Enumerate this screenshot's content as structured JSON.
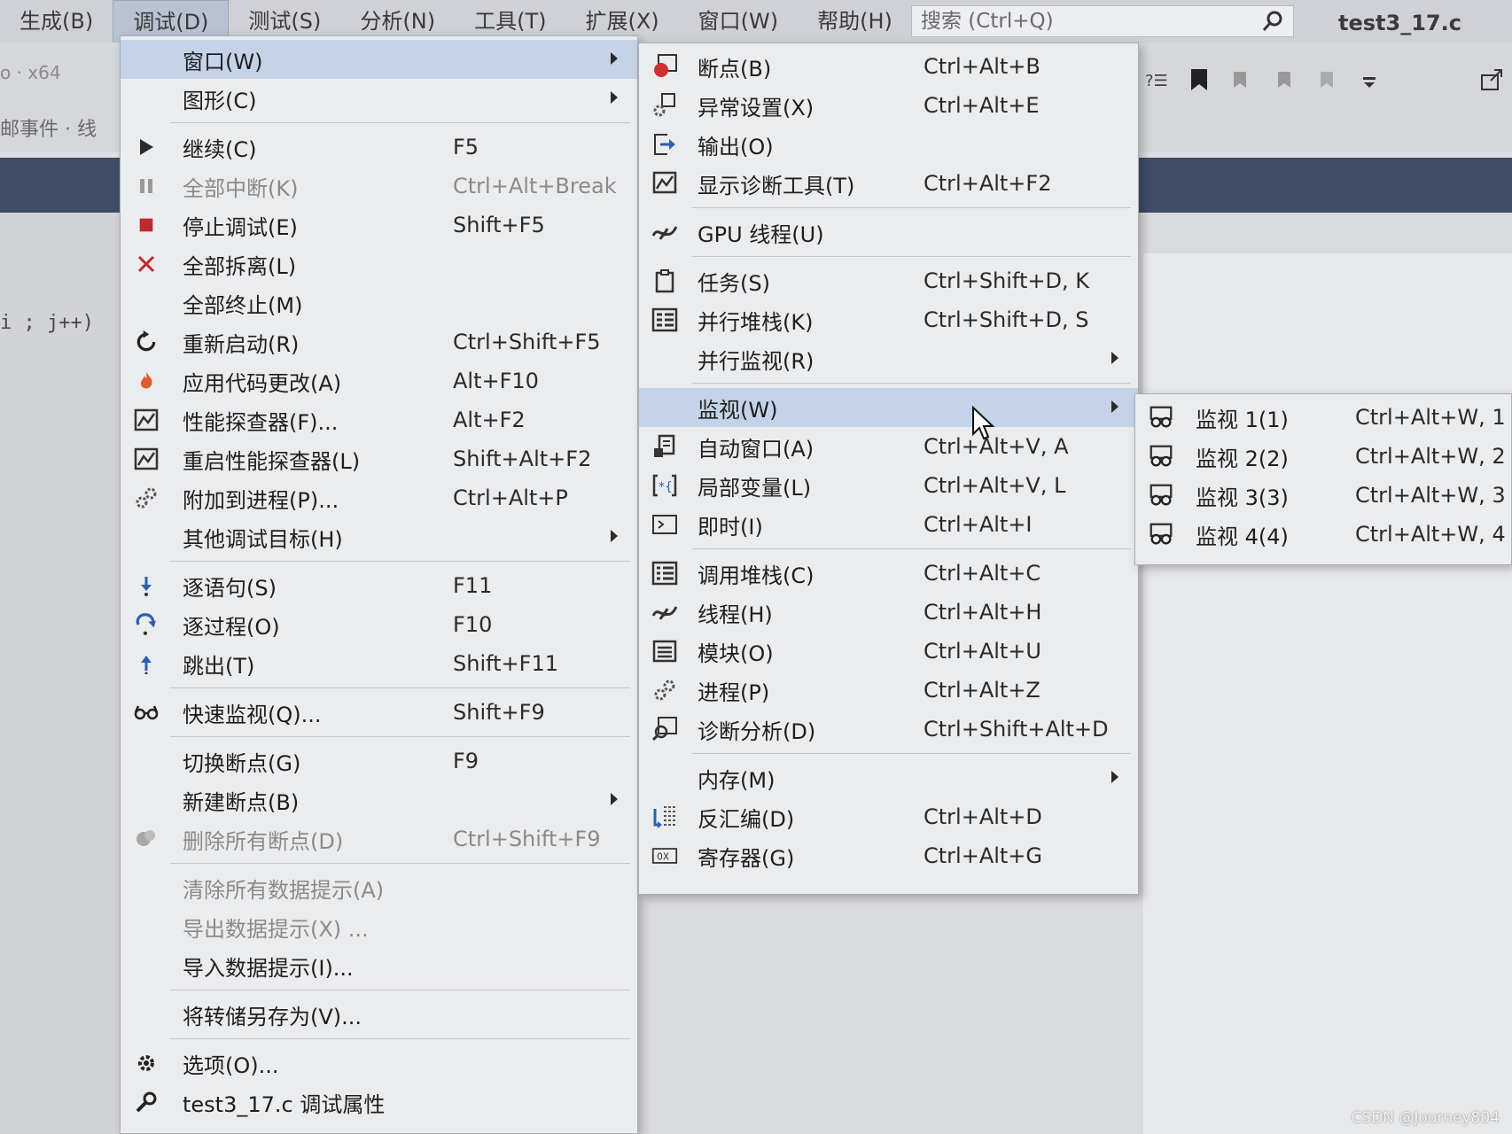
{
  "menubar": {
    "items": [
      "生成(B)",
      "调试(D)",
      "测试(S)",
      "分析(N)",
      "工具(T)",
      "扩展(X)",
      "窗口(W)",
      "帮助(H)"
    ],
    "active_index": 1,
    "search_placeholder": "搜索 (Ctrl+Q)",
    "project_title": "test3_17.c"
  },
  "toolbar": {
    "left_text_1": "o  ·  x64",
    "left_text_2": "邮事件 · 线"
  },
  "editor": {
    "code_fragment": "i ; j++)"
  },
  "debug_menu": {
    "items": [
      {
        "type": "item",
        "icon": "window-icon",
        "label": "窗口(W)",
        "shortcut": "",
        "submenu": true,
        "selected": true
      },
      {
        "type": "item",
        "icon": "",
        "label": "图形(C)",
        "shortcut": "",
        "submenu": true
      },
      {
        "type": "sep"
      },
      {
        "type": "item",
        "icon": "play-icon",
        "label": "继续(C)",
        "shortcut": "F5"
      },
      {
        "type": "item",
        "icon": "pause-icon",
        "label": "全部中断(K)",
        "shortcut": "Ctrl+Alt+Break",
        "disabled": true
      },
      {
        "type": "item",
        "icon": "stop-icon",
        "label": "停止调试(E)",
        "shortcut": "Shift+F5"
      },
      {
        "type": "item",
        "icon": "close-icon",
        "label": "全部拆离(L)",
        "shortcut": ""
      },
      {
        "type": "item",
        "icon": "",
        "label": "全部终止(M)",
        "shortcut": ""
      },
      {
        "type": "item",
        "icon": "restart-icon",
        "label": "重新启动(R)",
        "shortcut": "Ctrl+Shift+F5"
      },
      {
        "type": "item",
        "icon": "flame-icon",
        "label": "应用代码更改(A)",
        "shortcut": "Alt+F10"
      },
      {
        "type": "item",
        "icon": "profiler-icon",
        "label": "性能探查器(F)...",
        "shortcut": "Alt+F2"
      },
      {
        "type": "item",
        "icon": "profiler-icon",
        "label": "重启性能探查器(L)",
        "shortcut": "Shift+Alt+F2"
      },
      {
        "type": "item",
        "icon": "gears-icon",
        "label": "附加到进程(P)...",
        "shortcut": "Ctrl+Alt+P"
      },
      {
        "type": "item",
        "icon": "",
        "label": "其他调试目标(H)",
        "shortcut": "",
        "submenu": true
      },
      {
        "type": "sep"
      },
      {
        "type": "item",
        "icon": "step-into-icon",
        "label": "逐语句(S)",
        "shortcut": "F11"
      },
      {
        "type": "item",
        "icon": "step-over-icon",
        "label": "逐过程(O)",
        "shortcut": "F10"
      },
      {
        "type": "item",
        "icon": "step-out-icon",
        "label": "跳出(T)",
        "shortcut": "Shift+F11"
      },
      {
        "type": "sep"
      },
      {
        "type": "item",
        "icon": "glasses-icon",
        "label": "快速监视(Q)...",
        "shortcut": "Shift+F9"
      },
      {
        "type": "sep"
      },
      {
        "type": "item",
        "icon": "",
        "label": "切换断点(G)",
        "shortcut": "F9"
      },
      {
        "type": "item",
        "icon": "",
        "label": "新建断点(B)",
        "shortcut": "",
        "submenu": true
      },
      {
        "type": "item",
        "icon": "delete-breakpoints-icon",
        "label": "删除所有断点(D)",
        "shortcut": "Ctrl+Shift+F9",
        "disabled": true
      },
      {
        "type": "sep"
      },
      {
        "type": "item",
        "icon": "",
        "label": "清除所有数据提示(A)",
        "shortcut": "",
        "disabled": true
      },
      {
        "type": "item",
        "icon": "",
        "label": "导出数据提示(X) ...",
        "shortcut": "",
        "disabled": true
      },
      {
        "type": "item",
        "icon": "",
        "label": "导入数据提示(I)...",
        "shortcut": ""
      },
      {
        "type": "sep"
      },
      {
        "type": "item",
        "icon": "",
        "label": "将转储另存为(V)...",
        "shortcut": ""
      },
      {
        "type": "sep"
      },
      {
        "type": "item",
        "icon": "gear-icon",
        "label": "选项(O)...",
        "shortcut": ""
      },
      {
        "type": "item",
        "icon": "wrench-icon",
        "label": "test3_17.c 调试属性",
        "shortcut": ""
      }
    ]
  },
  "window_submenu": {
    "items": [
      {
        "type": "item",
        "icon": "breakpoint-icon",
        "label": "断点(B)",
        "shortcut": "Ctrl+Alt+B"
      },
      {
        "type": "item",
        "icon": "exception-icon",
        "label": "异常设置(X)",
        "shortcut": "Ctrl+Alt+E"
      },
      {
        "type": "item",
        "icon": "output-icon",
        "label": "输出(O)",
        "shortcut": ""
      },
      {
        "type": "item",
        "icon": "diagnostics-icon",
        "label": "显示诊断工具(T)",
        "shortcut": "Ctrl+Alt+F2"
      },
      {
        "type": "sep"
      },
      {
        "type": "item",
        "icon": "threads-icon",
        "label": "GPU 线程(U)",
        "shortcut": ""
      },
      {
        "type": "sep"
      },
      {
        "type": "item",
        "icon": "tasks-icon",
        "label": "任务(S)",
        "shortcut": "Ctrl+Shift+D, K"
      },
      {
        "type": "item",
        "icon": "parallel-stacks-icon",
        "label": "并行堆栈(K)",
        "shortcut": "Ctrl+Shift+D, S"
      },
      {
        "type": "item",
        "icon": "",
        "label": "并行监视(R)",
        "shortcut": "",
        "submenu": true
      },
      {
        "type": "sep"
      },
      {
        "type": "item",
        "icon": "",
        "label": "监视(W)",
        "shortcut": "",
        "submenu": true,
        "selected": true
      },
      {
        "type": "item",
        "icon": "autos-icon",
        "label": "自动窗口(A)",
        "shortcut": "Ctrl+Alt+V, A"
      },
      {
        "type": "item",
        "icon": "locals-icon",
        "label": "局部变量(L)",
        "shortcut": "Ctrl+Alt+V, L"
      },
      {
        "type": "item",
        "icon": "immediate-icon",
        "label": "即时(I)",
        "shortcut": "Ctrl+Alt+I"
      },
      {
        "type": "sep"
      },
      {
        "type": "item",
        "icon": "call-stack-icon",
        "label": "调用堆栈(C)",
        "shortcut": "Ctrl+Alt+C"
      },
      {
        "type": "item",
        "icon": "threads-icon",
        "label": "线程(H)",
        "shortcut": "Ctrl+Alt+H"
      },
      {
        "type": "item",
        "icon": "modules-icon",
        "label": "模块(O)",
        "shortcut": "Ctrl+Alt+U"
      },
      {
        "type": "item",
        "icon": "gears-icon",
        "label": "进程(P)",
        "shortcut": "Ctrl+Alt+Z"
      },
      {
        "type": "item",
        "icon": "diagnostic-analysis-icon",
        "label": "诊断分析(D)",
        "shortcut": "Ctrl+Shift+Alt+D"
      },
      {
        "type": "sep"
      },
      {
        "type": "item",
        "icon": "",
        "label": "内存(M)",
        "shortcut": "",
        "submenu": true
      },
      {
        "type": "item",
        "icon": "disassembly-icon",
        "label": "反汇编(D)",
        "shortcut": "Ctrl+Alt+D"
      },
      {
        "type": "item",
        "icon": "registers-icon",
        "label": "寄存器(G)",
        "shortcut": "Ctrl+Alt+G"
      }
    ]
  },
  "watch_submenu": {
    "items": [
      {
        "type": "item",
        "icon": "watch-icon",
        "label": "监视 1(1)",
        "shortcut": "Ctrl+Alt+W, 1"
      },
      {
        "type": "item",
        "icon": "watch-icon",
        "label": "监视 2(2)",
        "shortcut": "Ctrl+Alt+W, 2"
      },
      {
        "type": "item",
        "icon": "watch-icon",
        "label": "监视 3(3)",
        "shortcut": "Ctrl+Alt+W, 3"
      },
      {
        "type": "item",
        "icon": "watch-icon",
        "label": "监视 4(4)",
        "shortcut": "Ctrl+Alt+W, 4"
      }
    ]
  },
  "watermark": "CSDN @Journey804",
  "colors": {
    "accent_selection": "#c5d3e9",
    "breakpoint_red": "#d03030",
    "stop_red": "#c0282d",
    "play_green": "#2a2a2a"
  }
}
